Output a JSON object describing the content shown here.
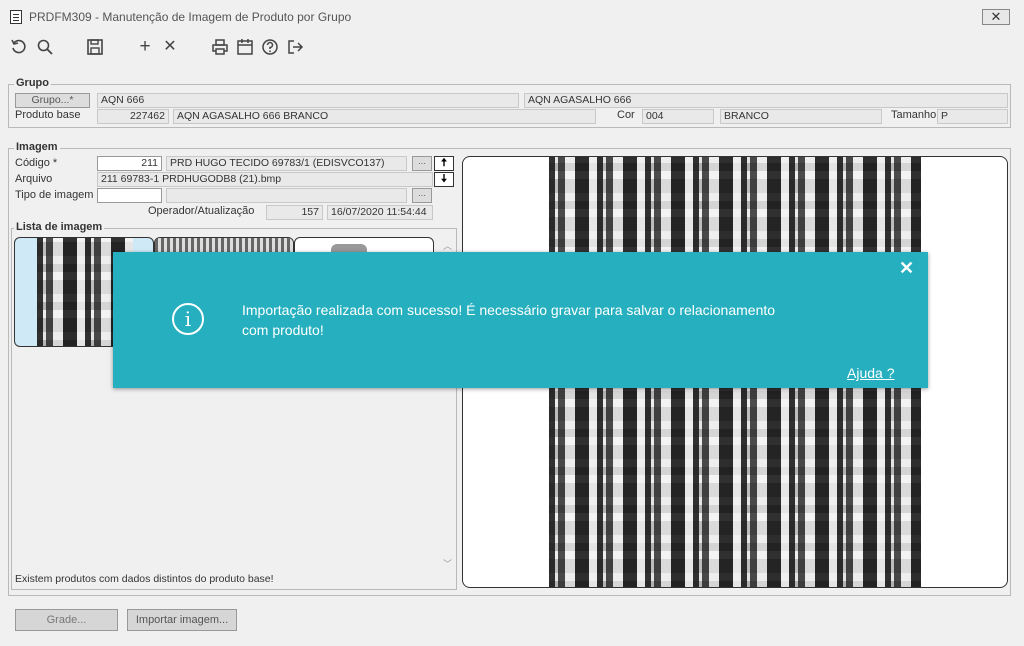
{
  "window": {
    "title": "PRDFM309 - Manutenção de Imagem de Produto por Grupo",
    "close_glyph": "✕"
  },
  "toolbar": {
    "icons": [
      "undo-icon",
      "search-icon",
      "save-icon",
      "add-icon",
      "close-icon",
      "print-icon",
      "calendar-icon",
      "help-icon",
      "exit-icon"
    ],
    "add_glyph": "+",
    "close_glyph": "✕"
  },
  "grupo": {
    "section_title": "Grupo",
    "grupo_button": "Grupo...*",
    "grupo_code": "AQN 666",
    "grupo_desc": "AQN AGASALHO 666",
    "produto_base_label": "Produto base",
    "produto_base_code": "227462",
    "produto_base_desc": "AQN AGASALHO 666 BRANCO",
    "cor_label": "Cor",
    "cor_code": "004",
    "cor_desc": "BRANCO",
    "tamanho_label": "Tamanho",
    "tamanho_value": "P"
  },
  "imagem": {
    "section_title": "Imagem",
    "codigo_label": "Código *",
    "codigo_value": "211",
    "codigo_desc": "PRD HUGO TECIDO 69783/1 (EDISVCO137)",
    "arquivo_label": "Arquivo",
    "arquivo_value": "211 69783-1 PRDHUGODB8 (21).bmp",
    "tipo_label": "Tipo de imagem",
    "tipo_value": "",
    "tipo_desc": "",
    "operador_label": "Operador/Atualização",
    "operador_value": "157",
    "atualizacao_value": "16/07/2020 11:54:44",
    "up_arrow": "🠅",
    "down_arrow": "🠇"
  },
  "lista": {
    "section_title": "Lista de imagem",
    "status_message": "Existem produtos com dados distintos do produto base!"
  },
  "dialog": {
    "message_line1": "Importação realizada com sucesso! É necessário gravar para salvar o relacionamento",
    "message_line2": "com produto!",
    "help_link": "Ajuda ?",
    "close_glyph": "✕",
    "info_glyph": "i",
    "accent_color": "#26b0bf"
  },
  "footer": {
    "grade_button": "Grade...",
    "importar_button": "Importar imagem..."
  }
}
